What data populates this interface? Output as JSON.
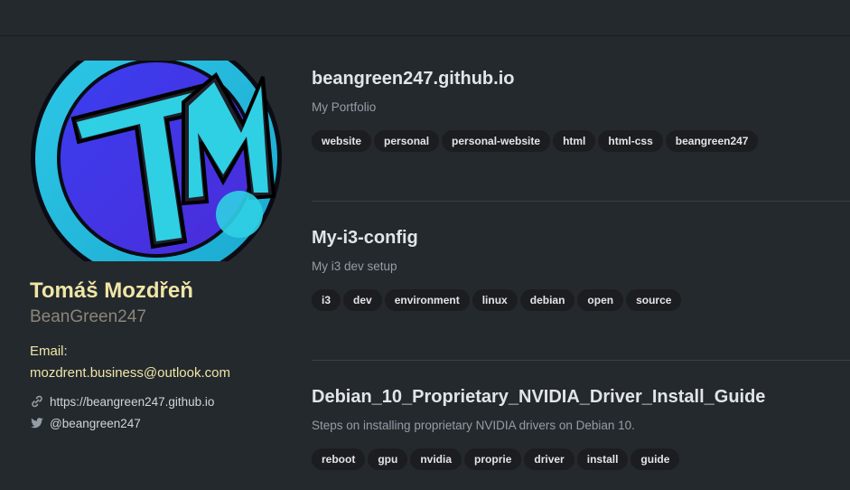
{
  "profile": {
    "name": "Tomáš Mozdřeň",
    "username": "BeanGreen247",
    "email_label": "Email:",
    "email": "mozdrent.business@outlook.com",
    "website": "https://beangreen247.github.io",
    "twitter": "@beangreen247",
    "avatar_monogram": "TM"
  },
  "repos": [
    {
      "title": "beangreen247.github.io",
      "description": "My Portfolio",
      "tags": [
        "website",
        "personal",
        "personal-website",
        "html",
        "html-css",
        "beangreen247"
      ]
    },
    {
      "title": "My-i3-config",
      "description": "My i3 dev setup",
      "tags": [
        "i3",
        "dev",
        "environment",
        "linux",
        "debian",
        "open",
        "source"
      ]
    },
    {
      "title": "Debian_10_Proprietary_NVIDIA_Driver_Install_Guide",
      "description": "Steps on installing proprietary NVIDIA drivers on Debian 10.",
      "tags": [
        "reboot",
        "gpu",
        "nvidia",
        "proprie",
        "driver",
        "install",
        "guide"
      ]
    }
  ],
  "colors": {
    "background": "#24292e",
    "name": "#f0e6a6",
    "tag_bg": "#1b1d21"
  },
  "icons": {
    "website": "link-icon",
    "twitter": "twitter-icon"
  }
}
